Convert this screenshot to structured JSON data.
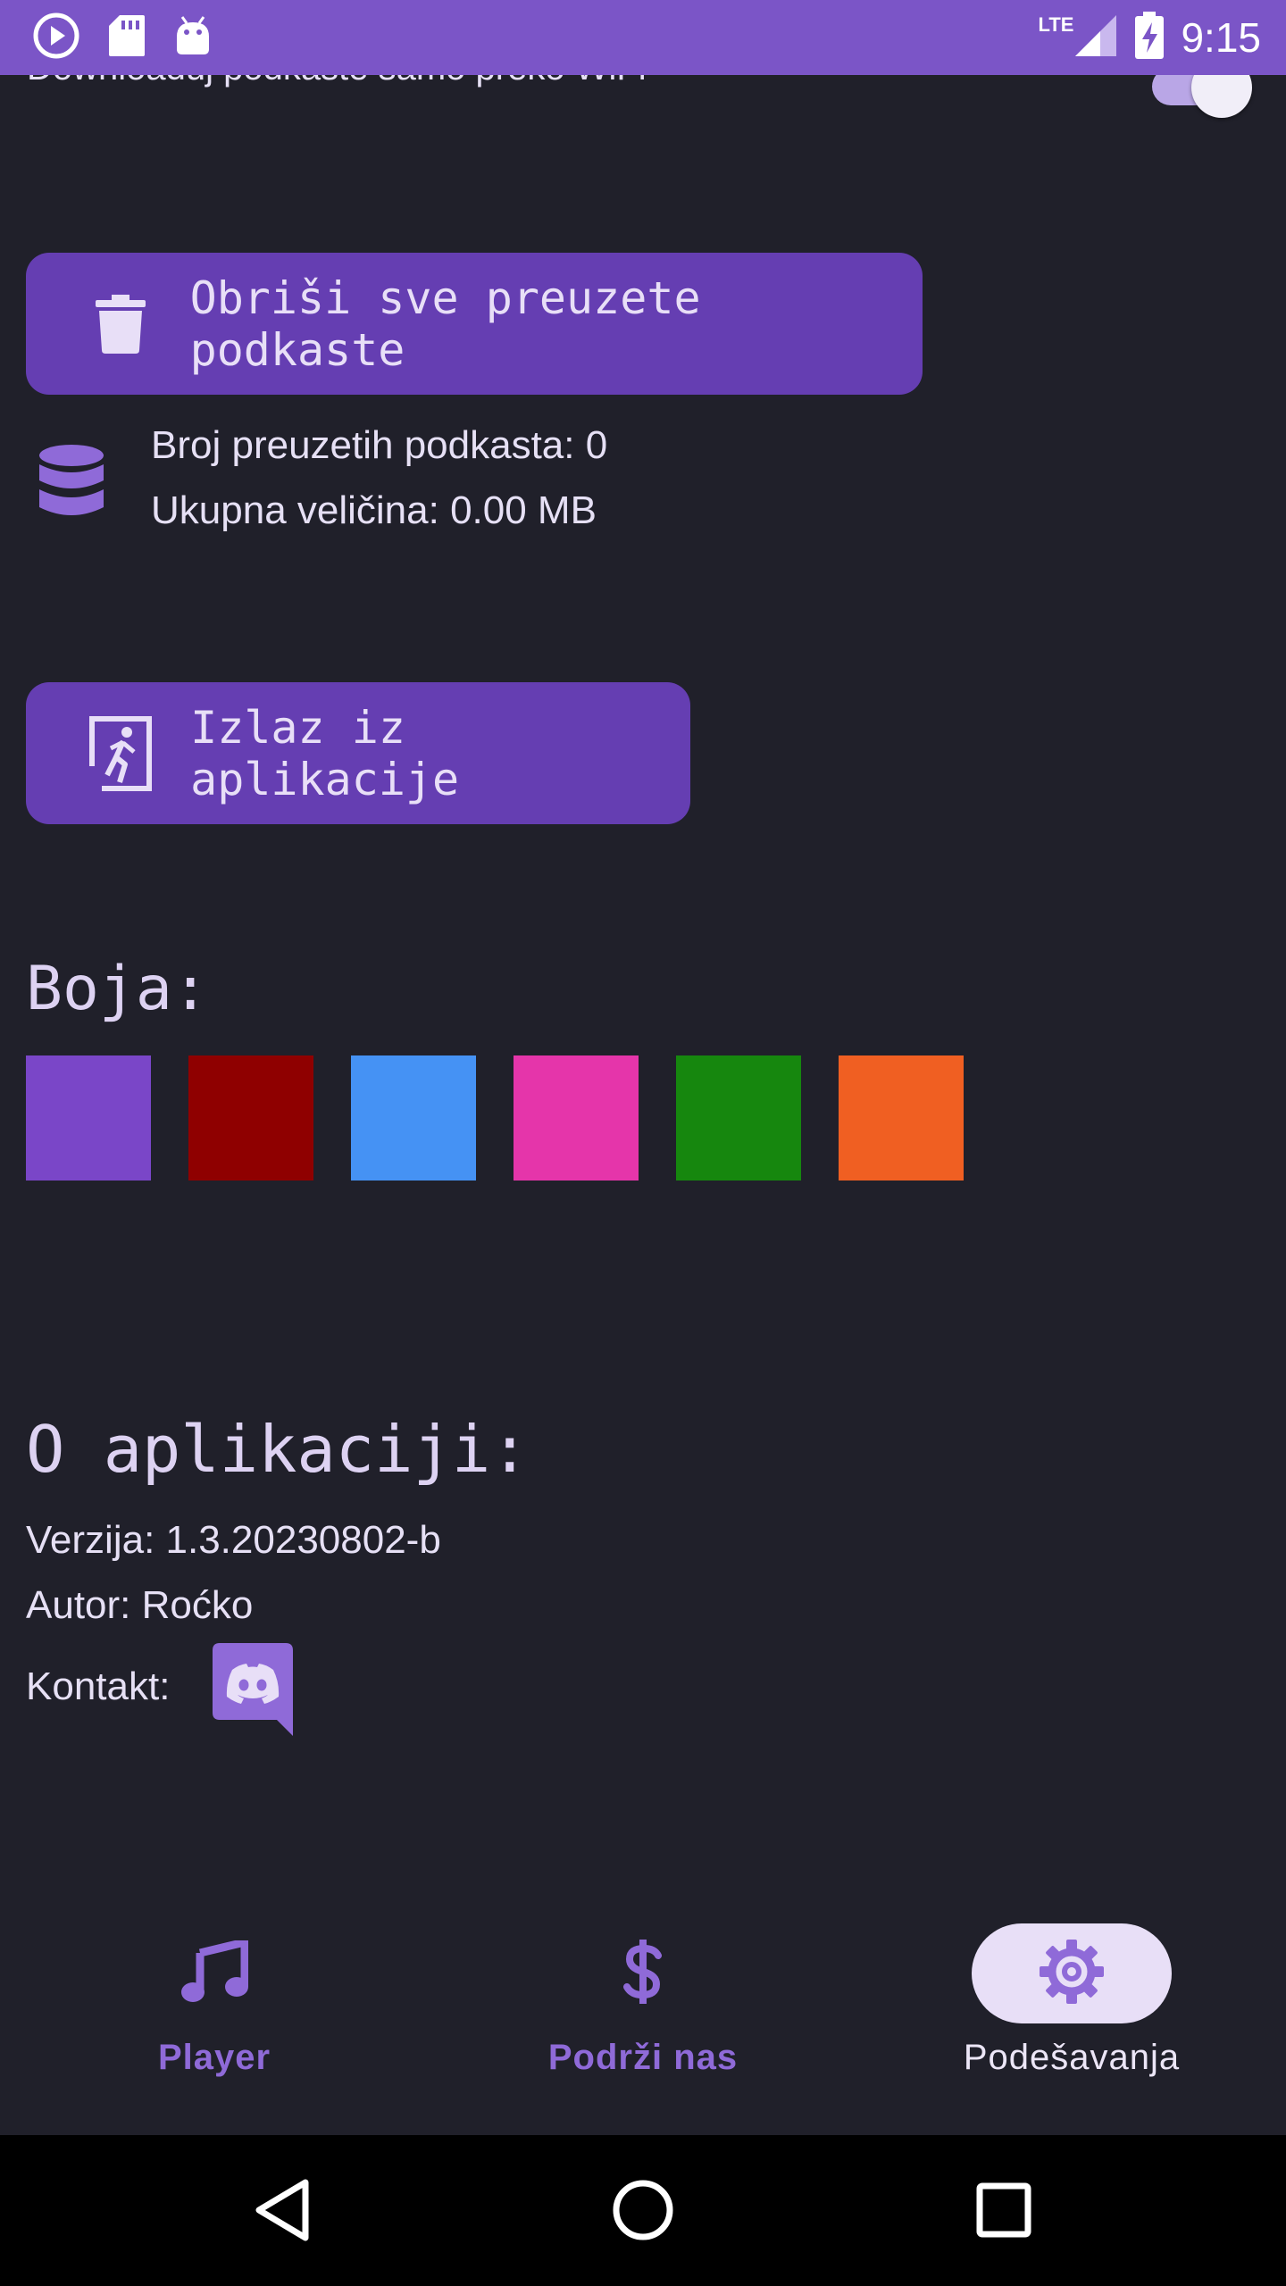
{
  "status_bar": {
    "network": "LTE",
    "time": "9:15"
  },
  "settings": {
    "wifi_only_label": "Downloaduj podkaste samo preko WiFi",
    "wifi_only_enabled": true,
    "delete_button_label": "Obriši sve preuzete podkaste",
    "downloaded_count_text": "Broj preuzetih podkasta: 0",
    "total_size_text": "Ukupna veličina: 0.00 MB",
    "exit_button_label": "Izlaz iz aplikacije",
    "color_title": "Boja:",
    "colors": [
      "#7a46c8",
      "#8f0000",
      "#4592f4",
      "#e535aa",
      "#16870e",
      "#f05f22"
    ]
  },
  "about": {
    "title": "O aplikaciji:",
    "version_text": "Verzija: 1.3.20230802-b",
    "author_text": "Autor: Roćko",
    "contact_label": "Kontakt:",
    "contact_icon": "discord-icon"
  },
  "bottom_nav": {
    "items": [
      {
        "label": "Player",
        "icon": "music-note-icon",
        "active": false
      },
      {
        "label": "Podrži nas",
        "icon": "dollar-icon",
        "active": false
      },
      {
        "label": "Podešavanja",
        "icon": "gear-icon",
        "active": true
      }
    ]
  },
  "theme": {
    "accent": "#653eb2",
    "status_bar": "#7b55c7",
    "background": "#20202a",
    "active_pill": "#e8dff7"
  }
}
